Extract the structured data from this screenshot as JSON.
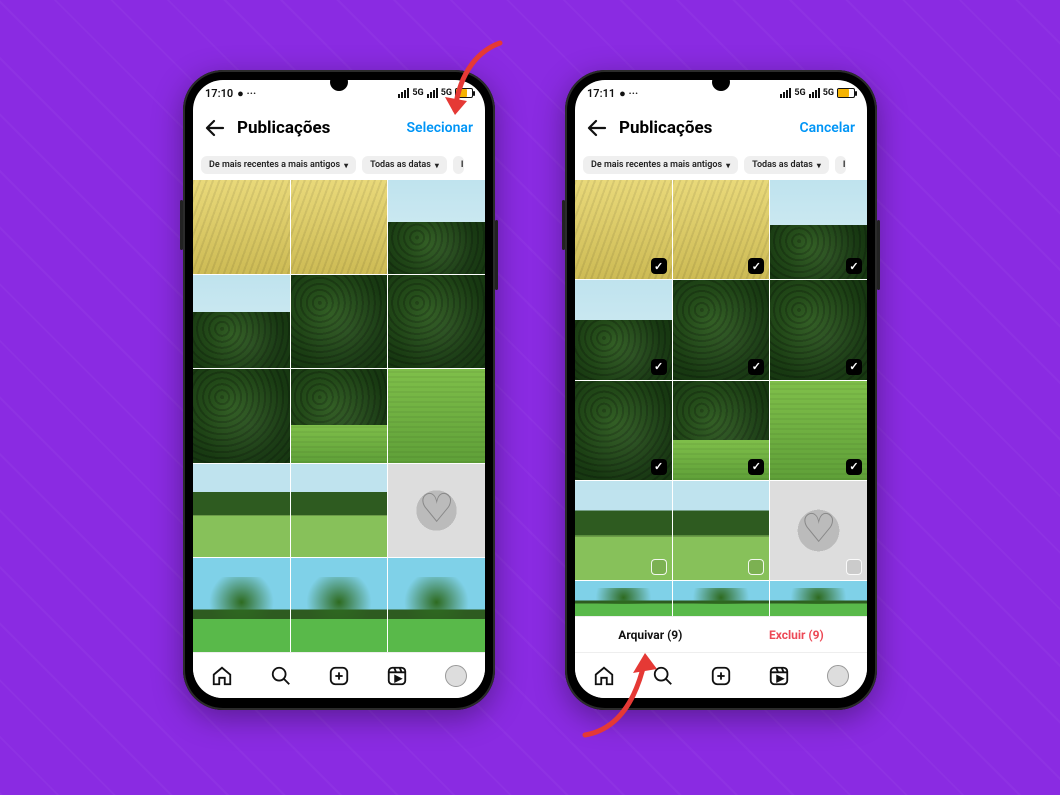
{
  "phone_left": {
    "status": {
      "time": "17:10",
      "net": "5G",
      "battery_pct": 85
    },
    "title": "Publicações",
    "action_label": "Selecionar",
    "filters": {
      "sort": "De mais recentes a mais antigos",
      "dates": "Todas as datas"
    },
    "nav": {
      "home": "home",
      "search": "search",
      "create": "create",
      "reels": "reels",
      "profile": "profile"
    }
  },
  "phone_right": {
    "status": {
      "time": "17:11",
      "net": "5G",
      "battery_pct": 85
    },
    "title": "Publicações",
    "action_label": "Cancelar",
    "filters": {
      "sort": "De mais recentes a mais antigos",
      "dates": "Todas as datas"
    },
    "actions": {
      "archive": "Arquivar (9)",
      "delete": "Excluir (9)"
    },
    "selection": {
      "row1_checked": true,
      "row3_col3_checked": true,
      "row4_empty": true
    },
    "nav": {
      "home": "home",
      "search": "search",
      "create": "create",
      "reels": "reels",
      "profile": "profile"
    }
  }
}
